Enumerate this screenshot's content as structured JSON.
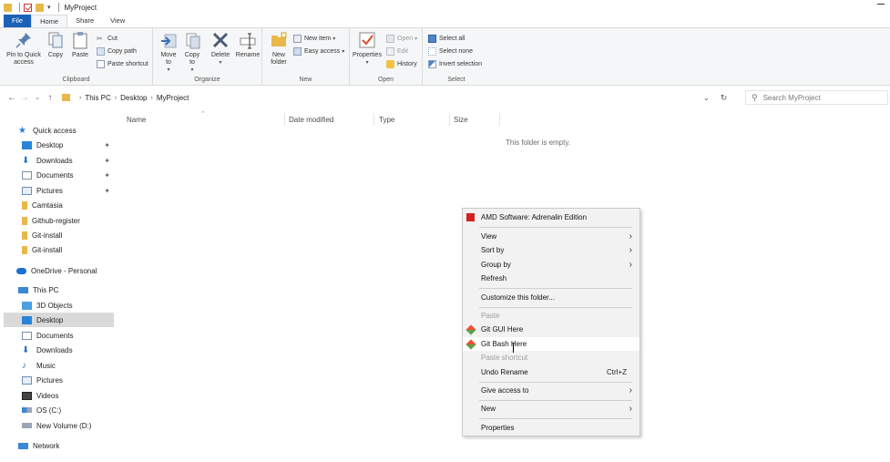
{
  "window": {
    "title": "MyProject"
  },
  "ribbon_tabs": [
    "File",
    "Home",
    "Share",
    "View"
  ],
  "ribbon": {
    "clipboard": {
      "label": "Clipboard",
      "pin_to_quick_access": "Pin to Quick access",
      "copy": "Copy",
      "paste": "Paste",
      "cut": "Cut",
      "copy_path": "Copy path",
      "paste_shortcut": "Paste shortcut"
    },
    "organize": {
      "label": "Organize",
      "move_to": "Move to",
      "copy_to": "Copy to",
      "delete": "Delete",
      "rename": "Rename"
    },
    "new": {
      "label": "New",
      "new_folder": "New folder",
      "new_item": "New item",
      "easy_access": "Easy access"
    },
    "open": {
      "label": "Open",
      "properties": "Properties",
      "open": "Open",
      "edit": "Edit",
      "history": "History"
    },
    "select": {
      "label": "Select",
      "select_all": "Select all",
      "select_none": "Select none",
      "invert_selection": "Invert selection"
    }
  },
  "address": {
    "crumbs": [
      "This PC",
      "Desktop",
      "MyProject"
    ],
    "search_placeholder": "Search MyProject"
  },
  "nav": {
    "quick_access": "Quick access",
    "quick_items": [
      "Desktop",
      "Downloads",
      "Documents",
      "Pictures",
      "Camtasia",
      "Github-register",
      "Git-install",
      "Git-install"
    ],
    "onedrive": "OneDrive - Personal",
    "this_pc": "This PC",
    "pc_items": [
      "3D Objects",
      "Desktop",
      "Documents",
      "Downloads",
      "Music",
      "Pictures",
      "Videos",
      "OS (C:)",
      "New Volume (D:)"
    ],
    "network": "Network",
    "selected": "Desktop"
  },
  "columns": [
    "Name",
    "Date modified",
    "Type",
    "Size"
  ],
  "empty_message": "This folder is empty.",
  "context_menu": {
    "amd": "AMD Software: Adrenalin Edition",
    "view": "View",
    "sort_by": "Sort by",
    "group_by": "Group by",
    "refresh": "Refresh",
    "customize": "Customize this folder...",
    "paste": "Paste",
    "git_gui": "Git GUI Here",
    "git_bash": "Git Bash Here",
    "paste_shortcut": "Paste shortcut",
    "undo_rename": "Undo Rename",
    "undo_shortcut": "Ctrl+Z",
    "give_access": "Give access to",
    "new": "New",
    "properties": "Properties"
  },
  "colors": {
    "file_tab": "#1a62b8",
    "folder": "#e8b84a",
    "accent": "#1a73d9",
    "amd": "#d32222"
  }
}
